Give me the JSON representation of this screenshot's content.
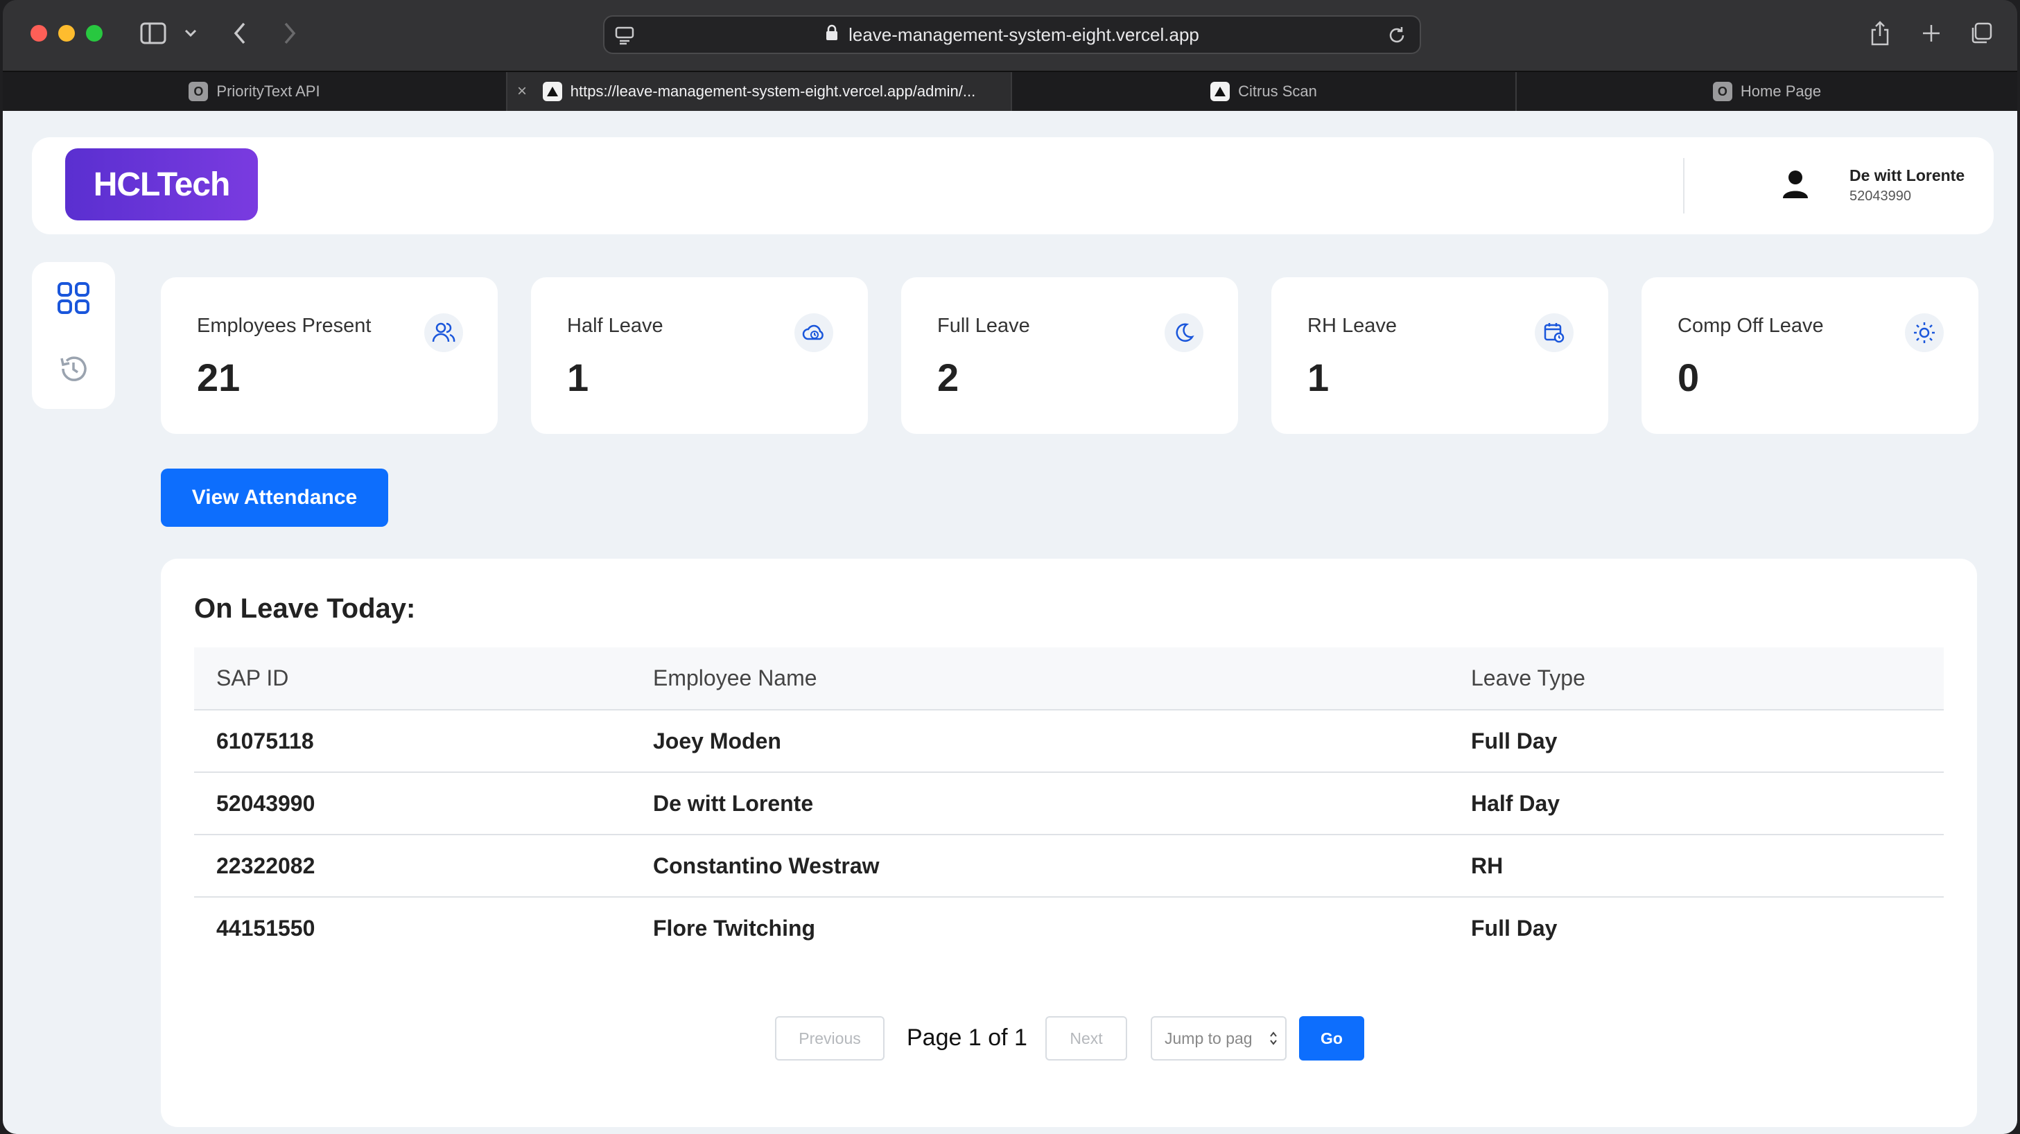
{
  "browser": {
    "url": "leave-management-system-eight.vercel.app",
    "tabs": [
      {
        "label": "PriorityText API",
        "favicon": "O"
      },
      {
        "label": "https://leave-management-system-eight.vercel.app/admin/...",
        "favicon": "triangle"
      },
      {
        "label": "Citrus Scan",
        "favicon": "triangle"
      },
      {
        "label": "Home Page",
        "favicon": "O"
      }
    ]
  },
  "header": {
    "logo": "HCLTech",
    "user_name": "De witt Lorente",
    "user_id": "52043990"
  },
  "stats": [
    {
      "label": "Employees Present",
      "value": "21",
      "icon": "users-icon"
    },
    {
      "label": "Half Leave",
      "value": "1",
      "icon": "cloud-clock-icon"
    },
    {
      "label": "Full Leave",
      "value": "2",
      "icon": "moon-icon"
    },
    {
      "label": "RH Leave",
      "value": "1",
      "icon": "calendar-clock-icon"
    },
    {
      "label": "Comp Off Leave",
      "value": "0",
      "icon": "sun-icon"
    }
  ],
  "actions": {
    "view_attendance": "View Attendance"
  },
  "leave_table": {
    "title": "On Leave Today:",
    "columns": [
      "SAP ID",
      "Employee Name",
      "Leave Type"
    ],
    "rows": [
      [
        "61075118",
        "Joey Moden",
        "Full Day"
      ],
      [
        "52043990",
        "De witt Lorente",
        "Half Day"
      ],
      [
        "22322082",
        "Constantino Westraw",
        "RH"
      ],
      [
        "44151550",
        "Flore Twitching",
        "Full Day"
      ]
    ]
  },
  "pagination": {
    "previous": "Previous",
    "page_text": "Page 1 of 1",
    "next": "Next",
    "jump_placeholder": "Jump to pag",
    "go": "Go"
  },
  "colors": {
    "primary": "#0d6efd",
    "logo_bg": "#5a2fd0",
    "page_bg": "#eef2f6"
  }
}
